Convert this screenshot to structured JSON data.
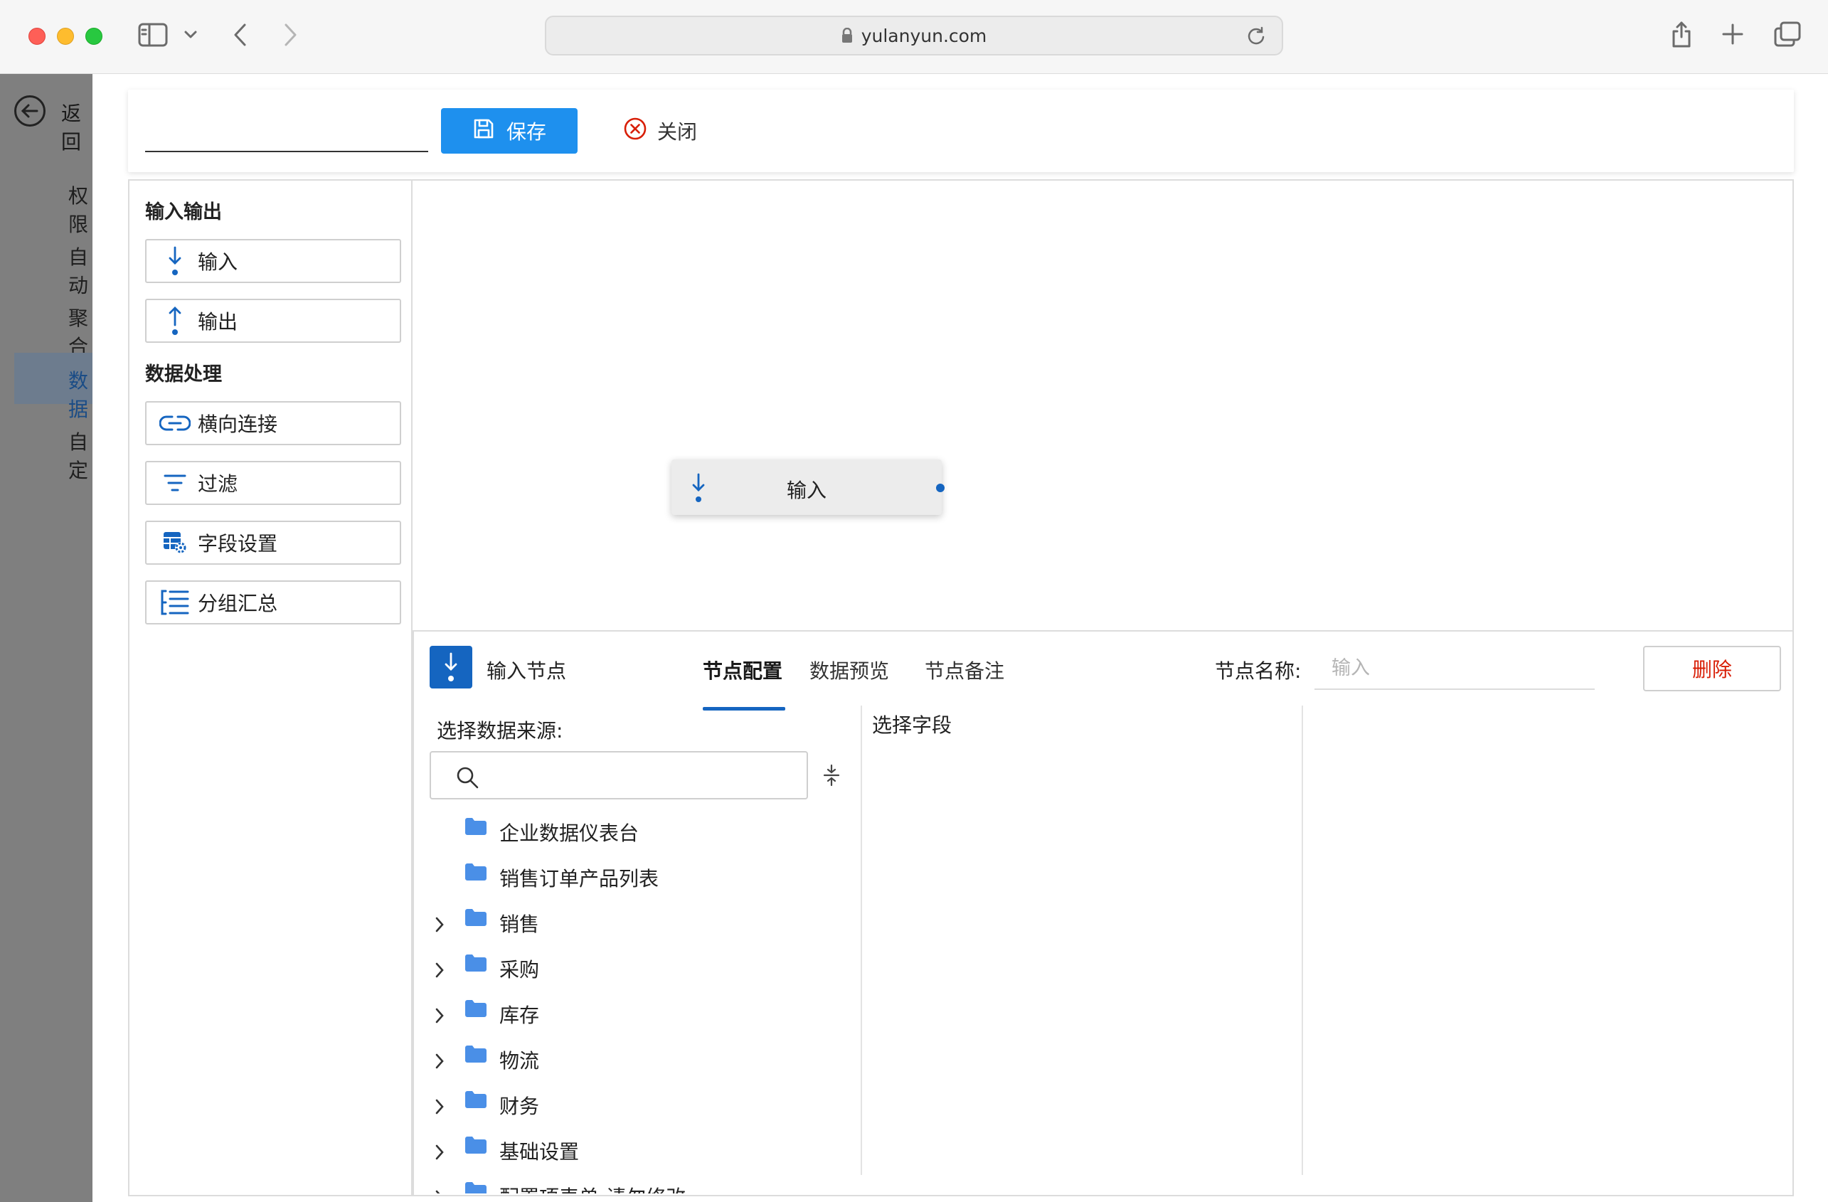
{
  "browser": {
    "url": "yulanyun.com"
  },
  "background_app": {
    "back_label": "返回",
    "items": [
      "权限",
      "自动",
      "聚合",
      "数据",
      "自定"
    ]
  },
  "toolbar": {
    "name_value": "",
    "save_label": "保存",
    "close_label": "关闭"
  },
  "palette": {
    "section_io": "输入输出",
    "io_items": [
      {
        "label": "输入",
        "icon": "arrow-down-dot-icon"
      },
      {
        "label": "输出",
        "icon": "arrow-up-dot-icon"
      }
    ],
    "section_processing": "数据处理",
    "processing_items": [
      {
        "label": "横向连接",
        "icon": "link-icon"
      },
      {
        "label": "过滤",
        "icon": "filter-icon"
      },
      {
        "label": "字段设置",
        "icon": "table-gear-icon"
      },
      {
        "label": "分组汇总",
        "icon": "group-list-icon"
      }
    ]
  },
  "canvas": {
    "node_label": "输入"
  },
  "config": {
    "title": "输入节点",
    "tabs": [
      "节点配置",
      "数据预览",
      "节点备注"
    ],
    "active_tab": "节点配置",
    "node_name_label": "节点名称:",
    "node_name_placeholder": "输入",
    "node_name_value": "",
    "delete_label": "删除",
    "source_label": "选择数据来源:",
    "search_value": "",
    "fields_label": "选择字段",
    "tree": [
      {
        "label": "企业数据仪表台",
        "expandable": false
      },
      {
        "label": "销售订单产品列表",
        "expandable": false
      },
      {
        "label": "销售",
        "expandable": true
      },
      {
        "label": "采购",
        "expandable": true
      },
      {
        "label": "库存",
        "expandable": true
      },
      {
        "label": "物流",
        "expandable": true
      },
      {
        "label": "财务",
        "expandable": true
      },
      {
        "label": "基础设置",
        "expandable": true
      },
      {
        "label": "配置项表单-请勿修改",
        "expandable": true
      }
    ]
  },
  "colors": {
    "primary": "#1e90ee",
    "accent_dark": "#1565c0",
    "danger": "#d81e06",
    "folder": "#4a8fe7"
  }
}
